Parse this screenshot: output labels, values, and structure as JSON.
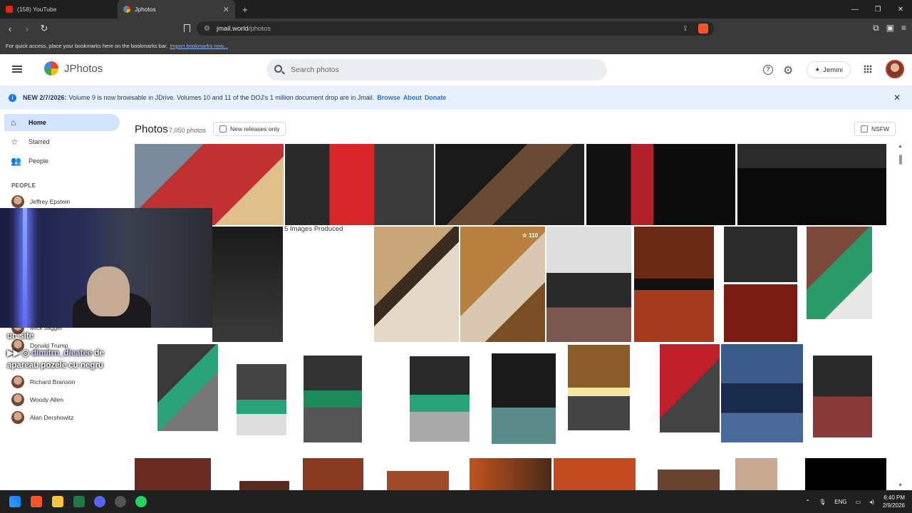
{
  "browser": {
    "tabs": [
      {
        "label": "(158) YouTube",
        "active": false
      },
      {
        "label": "Jphotos",
        "active": true
      }
    ],
    "url_domain": "jmail.world",
    "url_path": "/photos",
    "bookmarks_text": "For quick access, place your bookmarks here on the bookmarks bar.",
    "bookmarks_link": "Import bookmarks now..."
  },
  "header": {
    "app_name": "JPhotos",
    "search_placeholder": "Search photos",
    "jemini_label": "Jemini"
  },
  "banner": {
    "tag": "NEW 2/7/2026:",
    "text": "Volume 9 is now browsable in JDrive. Volumes 10 and 11 of the DOJ's 1 million document drop are in Jmail.",
    "browse": "Browse",
    "about": "About",
    "donate": "Donate"
  },
  "sidebar": {
    "nav": [
      {
        "label": "Home",
        "icon": "home-icon"
      },
      {
        "label": "Starred",
        "icon": "star-icon"
      },
      {
        "label": "People",
        "icon": "people-icon"
      }
    ],
    "people_heading": "PEOPLE",
    "people": [
      "Jeffrey Epstein",
      "Mick Jagger",
      "Donald Trump",
      "Richard Branson",
      "Woody Allen",
      "Alan Dershowitz"
    ]
  },
  "main": {
    "title": "Photos",
    "count": "7,050 photos",
    "new_releases": "New releases only",
    "nsfw": "NSFW",
    "caption_fragment": "5 Images Produced",
    "star_count": "110"
  },
  "overlay": {
    "line1": "un site",
    "user": "dimitrn_dieatee",
    "line2": "de",
    "line3": "apareau pozele cu negru"
  },
  "taskbar": {
    "lang": "ENG",
    "time": "6:40 PM",
    "date": "2/9/2026"
  }
}
